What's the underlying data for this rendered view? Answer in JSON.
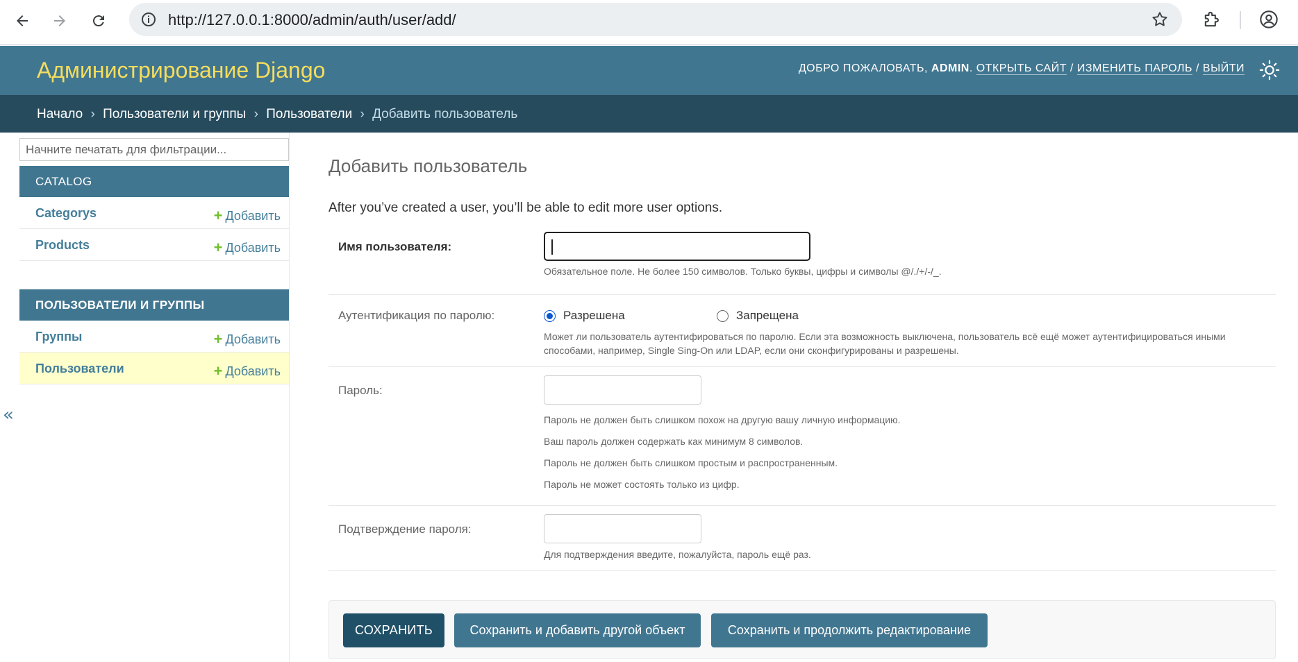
{
  "browser": {
    "url": "http://127.0.0.1:8000/admin/auth/user/add/"
  },
  "header": {
    "branding": "Администрирование Django",
    "welcome": "ДОБРО ПОЖАЛОВАТЬ,",
    "username": "ADMIN",
    "links": [
      "ОТКРЫТЬ САЙТ",
      "ИЗМЕНИТЬ ПАРОЛЬ",
      "ВЫЙТИ"
    ],
    "separator": "/"
  },
  "breadcrumbs": {
    "items": [
      "Начало",
      "Пользователи и группы",
      "Пользователи"
    ],
    "current": "Добавить пользователь",
    "separator": "›"
  },
  "sidebar": {
    "filter_placeholder": "Начните печатать для фильтрации...",
    "add_label": "Добавить",
    "toggle": "«",
    "modules": [
      {
        "caption": "CATALOG",
        "models": [
          "Categorys",
          "Products"
        ]
      },
      {
        "caption": "ПОЛЬЗОВАТЕЛИ И ГРУППЫ",
        "models": [
          "Группы",
          "Пользователи"
        ]
      }
    ]
  },
  "content": {
    "title": "Добавить пользователь",
    "intro": "After you’ve created a user, you’ll be able to edit more user options.",
    "username": {
      "label": "Имя пользователя:",
      "value": "",
      "help": "Обязательное поле. Не более 150 символов. Только буквы, цифры и символы @/./+/-/_."
    },
    "password_auth": {
      "label": "Аутентификация по паролю:",
      "options": [
        "Разрешена",
        "Запрещена"
      ],
      "selected": "Разрешена",
      "help": "Может ли пользователь аутентифироваться по паролю. Если эта возможность выключена, пользователь всё ещё может аутентифицироваться иными способами, например, Single Sing-On или LDAP, если они сконфигурированы и разрешены."
    },
    "password": {
      "label": "Пароль:",
      "help": [
        "Пароль не должен быть слишком похож на другую вашу личную информацию.",
        "Ваш пароль должен содержать как минимум 8 символов.",
        "Пароль не должен быть слишком простым и распространенным.",
        "Пароль не может состоять только из цифр."
      ]
    },
    "password_confirm": {
      "label": "Подтверждение пароля:",
      "help": "Для подтверждения введите, пожалуйста, пароль ещё раз."
    }
  },
  "submit": {
    "save": "СОХРАНИТЬ",
    "save_add_another": "Сохранить и добавить другой объект",
    "save_continue": "Сохранить и продолжить редактирование"
  },
  "colors": {
    "header": "#417690",
    "breadcrumbs": "#264b5d",
    "branding": "#f5dd5d",
    "link": "#447e9b",
    "add_plus": "#70bf2b",
    "current_row": "#ffffcc"
  }
}
